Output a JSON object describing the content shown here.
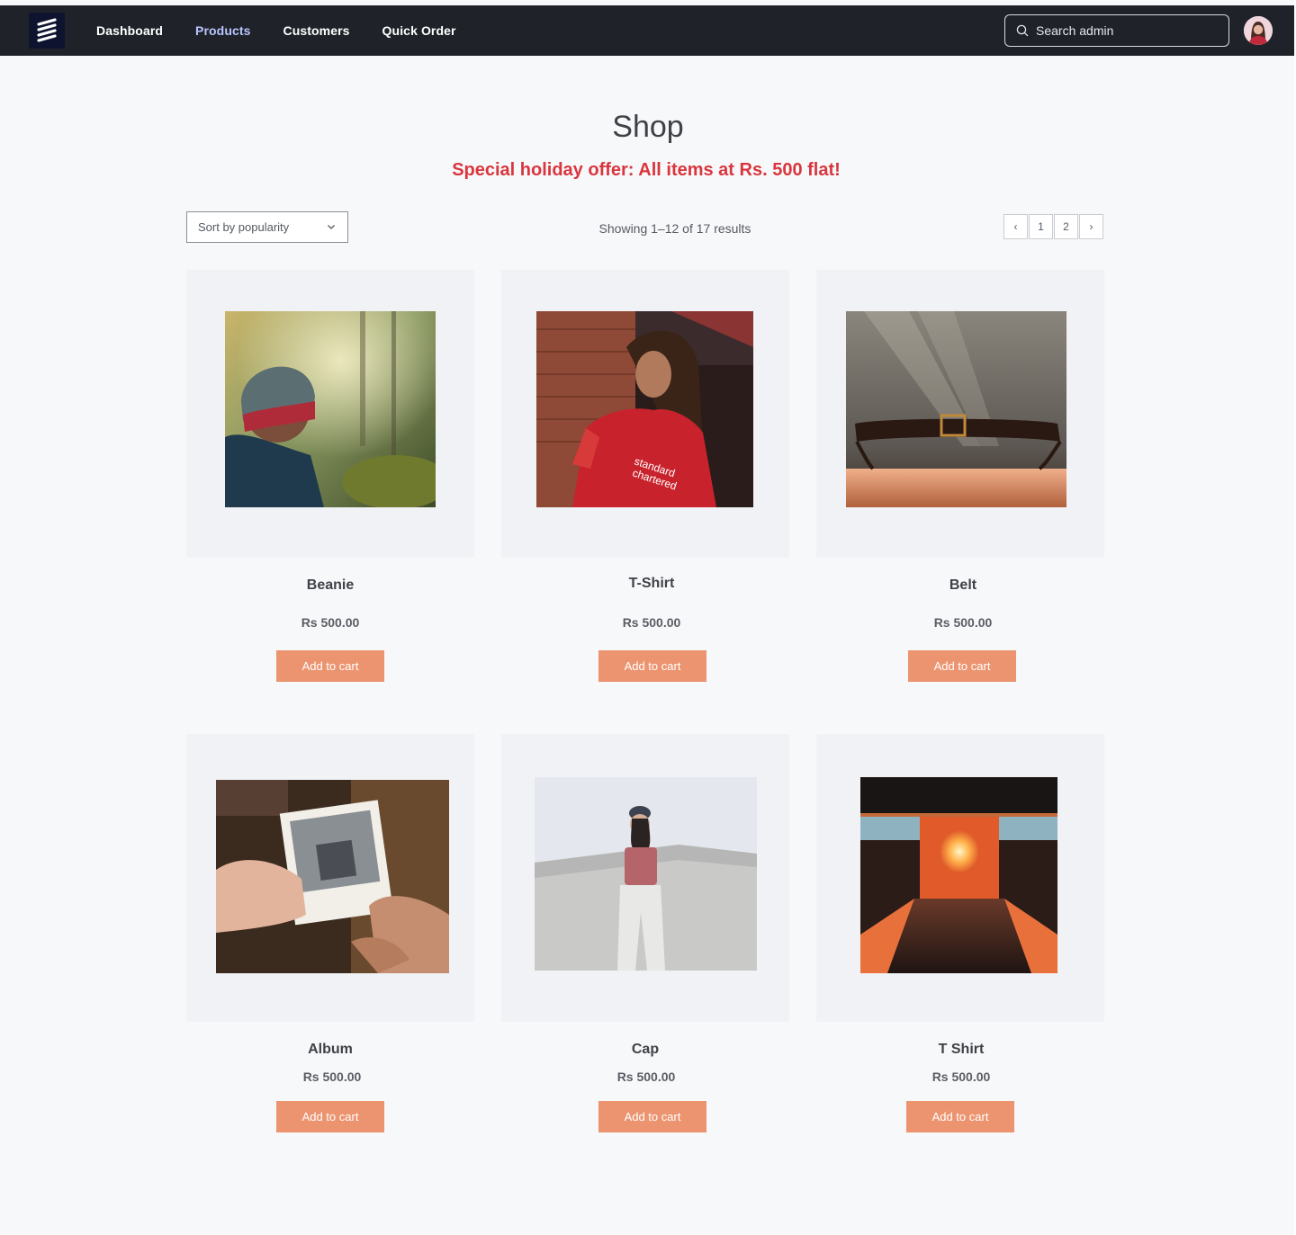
{
  "nav": {
    "logo": "stacked-stripes-logo",
    "items": [
      {
        "label": "Dashboard",
        "active": false
      },
      {
        "label": "Products",
        "active": true
      },
      {
        "label": "Customers",
        "active": false
      },
      {
        "label": "Quick Order",
        "active": false
      }
    ],
    "search_placeholder": "Search admin",
    "avatar": "user-avatar"
  },
  "page": {
    "title": "Shop",
    "offer": "Special holiday offer: All items at Rs. 500 flat!",
    "offer_color": "#d9363e"
  },
  "toolbar": {
    "sort_selected": "Sort by popularity",
    "results": "Showing 1–12 of 17 results",
    "pages": [
      "1",
      "2"
    ],
    "prev": "‹",
    "next": "›"
  },
  "products": [
    {
      "name": "Beanie",
      "price": "Rs 500.00",
      "button": "Add to cart",
      "image": "person-in-beanie-forest"
    },
    {
      "name": "T-Shirt",
      "price": "Rs 500.00",
      "button": "Add to cart",
      "image": "woman-in-red-jersey"
    },
    {
      "name": "Belt",
      "price": "Rs 500.00",
      "button": "Add to cart",
      "image": "leather-belt-on-table"
    },
    {
      "name": "Album",
      "price": "Rs 500.00",
      "button": "Add to cart",
      "image": "hands-holding-polaroid"
    },
    {
      "name": "Cap",
      "price": "Rs 500.00",
      "button": "Add to cart",
      "image": "woman-in-cap-by-wall"
    },
    {
      "name": "T Shirt",
      "price": "Rs 500.00",
      "button": "Add to cart",
      "image": "sunset-doorway"
    }
  ],
  "colors": {
    "navbar": "#1f2329",
    "active_nav": "#b9c4ff",
    "button": "#ec9470",
    "page_bg": "#f7f8fa"
  }
}
